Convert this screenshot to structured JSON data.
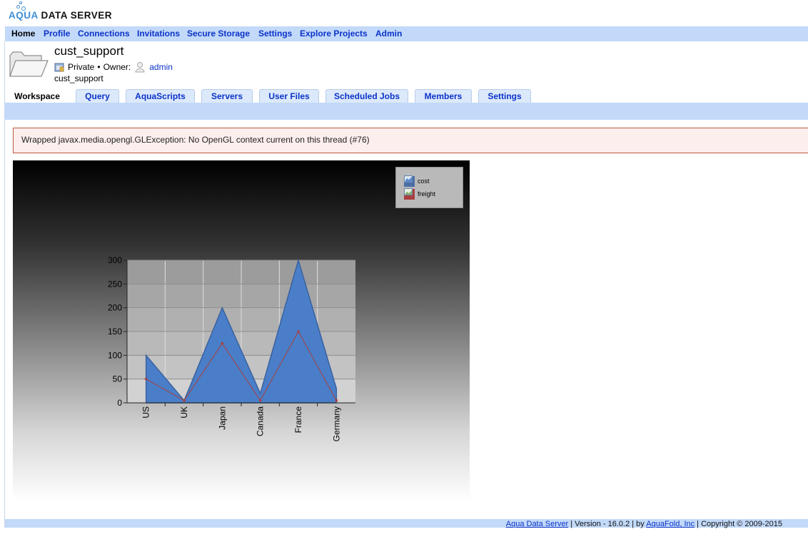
{
  "app": {
    "brand_accent": "AQUA",
    "brand_rest": " DATA SERVER"
  },
  "nav": [
    {
      "label": "Home",
      "active": true
    },
    {
      "label": "Profile"
    },
    {
      "label": "Connections"
    },
    {
      "label": "Invitations"
    },
    {
      "label": "Secure Storage"
    },
    {
      "label": "Settings"
    },
    {
      "label": "Explore Projects"
    },
    {
      "label": "Admin"
    }
  ],
  "project": {
    "title": "cust_support",
    "privacy": "Private",
    "separator": "•",
    "owner_label": "Owner:",
    "owner": "admin",
    "subtitle": "cust_support"
  },
  "tabs": [
    {
      "label": "Workspace",
      "active": true
    },
    {
      "label": "Query"
    },
    {
      "label": "AquaScripts"
    },
    {
      "label": "Servers"
    },
    {
      "label": "User Files"
    },
    {
      "label": "Scheduled Jobs"
    },
    {
      "label": "Members"
    },
    {
      "label": "Settings"
    }
  ],
  "error": {
    "message": "Wrapped javax.media.opengl.GLException: No OpenGL context current on this thread (#76)"
  },
  "colors": {
    "nav_bg": "#c2d9f9",
    "link": "#0b33c9",
    "error_bg": "#fdeeee",
    "error_border": "#c0593c",
    "cost": "#4a7ec8",
    "freight": "#a84040"
  },
  "chart_data": {
    "type": "area",
    "categories": [
      "US",
      "UK",
      "Japan",
      "Canada",
      "France",
      "Germany"
    ],
    "series": [
      {
        "name": "cost",
        "values": [
          100,
          5,
          200,
          20,
          300,
          30
        ],
        "color": "#4a7ec8"
      },
      {
        "name": "freight",
        "values": [
          50,
          5,
          125,
          5,
          150,
          5
        ],
        "color": "#a84040"
      }
    ],
    "ylim": [
      0,
      300
    ],
    "yticks": [
      "0",
      "50",
      "100",
      "150",
      "200",
      "250",
      "300"
    ],
    "legend": "top-right",
    "grid": true
  },
  "footer": {
    "link1": "Aqua Data Server",
    "version_text": " | Version - 16.0.2 | by ",
    "link2": "AquaFold, Inc",
    "copyright": " | Copyright © 2009-2015"
  }
}
